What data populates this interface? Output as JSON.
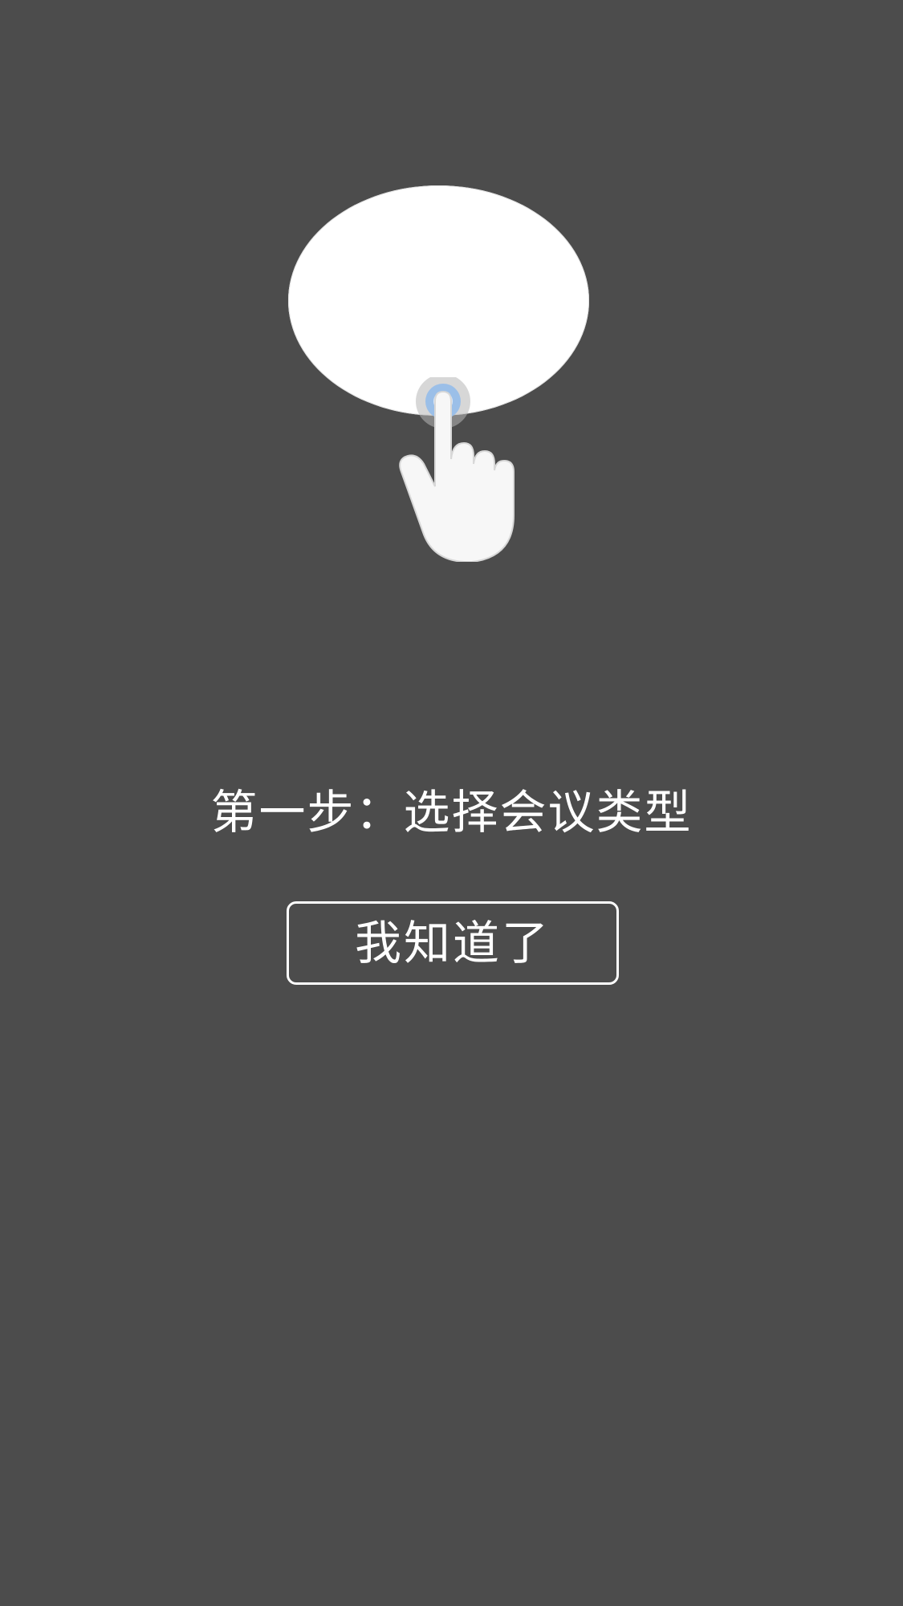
{
  "guide": {
    "step_text": "第一步：选择会议类型",
    "confirm_label": "我知道了"
  },
  "icons": {
    "spotlight": "tap-target-highlight",
    "hand": "pointing-hand-icon"
  },
  "colors": {
    "overlay_background": "#4c4c4c",
    "spotlight": "#ffffff",
    "touch_ring": "#9bbfe8",
    "text": "#ffffff"
  }
}
